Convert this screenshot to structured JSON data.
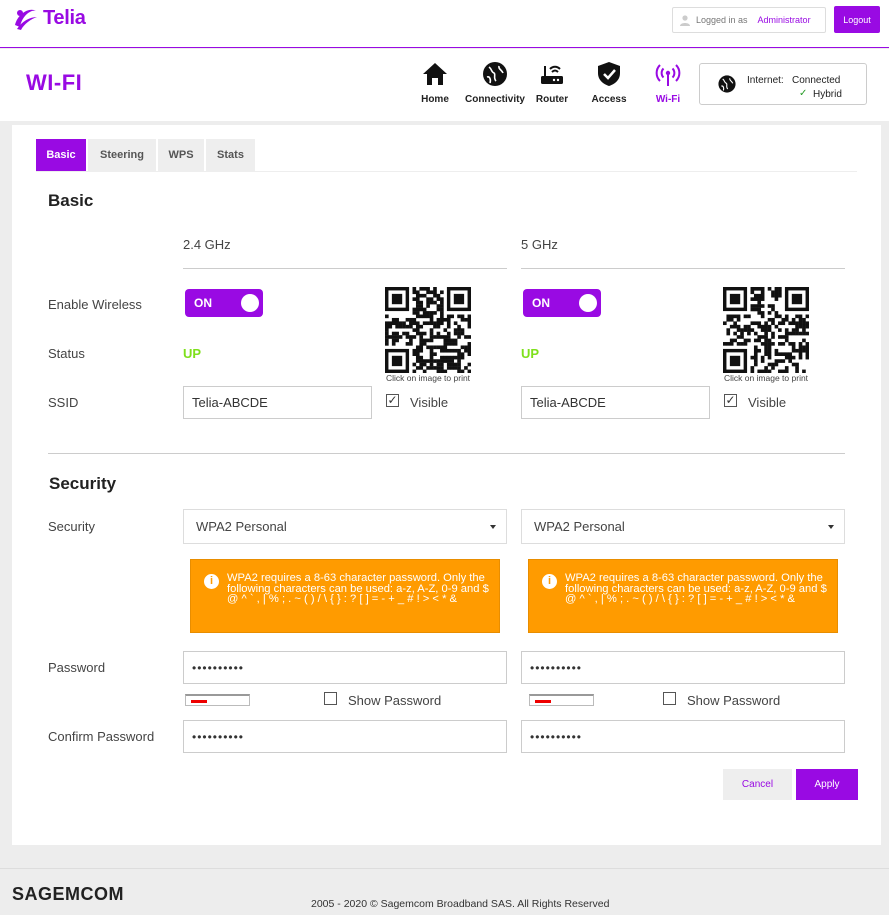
{
  "header": {
    "brand": "Telia",
    "logged_in_prefix": "Logged in as",
    "user": "Administrator",
    "logout": "Logout"
  },
  "page": {
    "title": "WI-FI"
  },
  "nav": [
    {
      "label": "Home",
      "icon": "home-icon"
    },
    {
      "label": "Connectivity",
      "icon": "globe-icon"
    },
    {
      "label": "Router",
      "icon": "router-icon"
    },
    {
      "label": "Access",
      "icon": "shield-icon"
    },
    {
      "label": "Wi-Fi",
      "icon": "wifi-icon",
      "active": true
    }
  ],
  "internet": {
    "label": "Internet:",
    "state": "Connected",
    "mode": "Hybrid"
  },
  "tabs": [
    "Basic",
    "Steering",
    "WPS",
    "Stats"
  ],
  "basic": {
    "title": "Basic",
    "labels": {
      "enable": "Enable Wireless",
      "status": "Status",
      "ssid": "SSID"
    },
    "bands": [
      {
        "name": "2.4 GHz",
        "toggle": "ON",
        "status": "UP",
        "ssid": "Telia-ABCDE",
        "qr_caption": "Click on image to print",
        "visible": "Visible"
      },
      {
        "name": "5 GHz",
        "toggle": "ON",
        "status": "UP",
        "ssid": "Telia-ABCDE",
        "qr_caption": "Click on image to print",
        "visible": "Visible"
      }
    ]
  },
  "security": {
    "title": "Security",
    "labels": {
      "security": "Security",
      "password": "Password",
      "confirm": "Confirm Password"
    },
    "bands": [
      {
        "mode": "WPA2 Personal",
        "warning": "WPA2 requires a 8-63 character password. Only the following characters can be used: a-z, A-Z, 0-9 and $ @ ^ ` , | % ; . ~ ( ) / \\ { } : ? [ ] = - + _ # ! > < * &",
        "password": "••••••••••",
        "show": "Show Password",
        "confirm": "••••••••••"
      },
      {
        "mode": "WPA2 Personal",
        "warning": "WPA2 requires a 8-63 character password. Only the following characters can be used: a-z, A-Z, 0-9 and $ @ ^ ` , | % ; . ~ ( ) / \\ { } : ? [ ] = - + _ # ! > < * &",
        "password": "••••••••••",
        "show": "Show Password",
        "confirm": "••••••••••"
      }
    ]
  },
  "actions": {
    "cancel": "Cancel",
    "apply": "Apply"
  },
  "footer": {
    "brand": "SAGEMCOM",
    "copyright": "2005 - 2020 © Sagemcom Broadband SAS. All Rights Reserved"
  },
  "colors": {
    "accent": "#990ae3",
    "warning": "#ff9b00",
    "status_up": "#7ee01b"
  }
}
